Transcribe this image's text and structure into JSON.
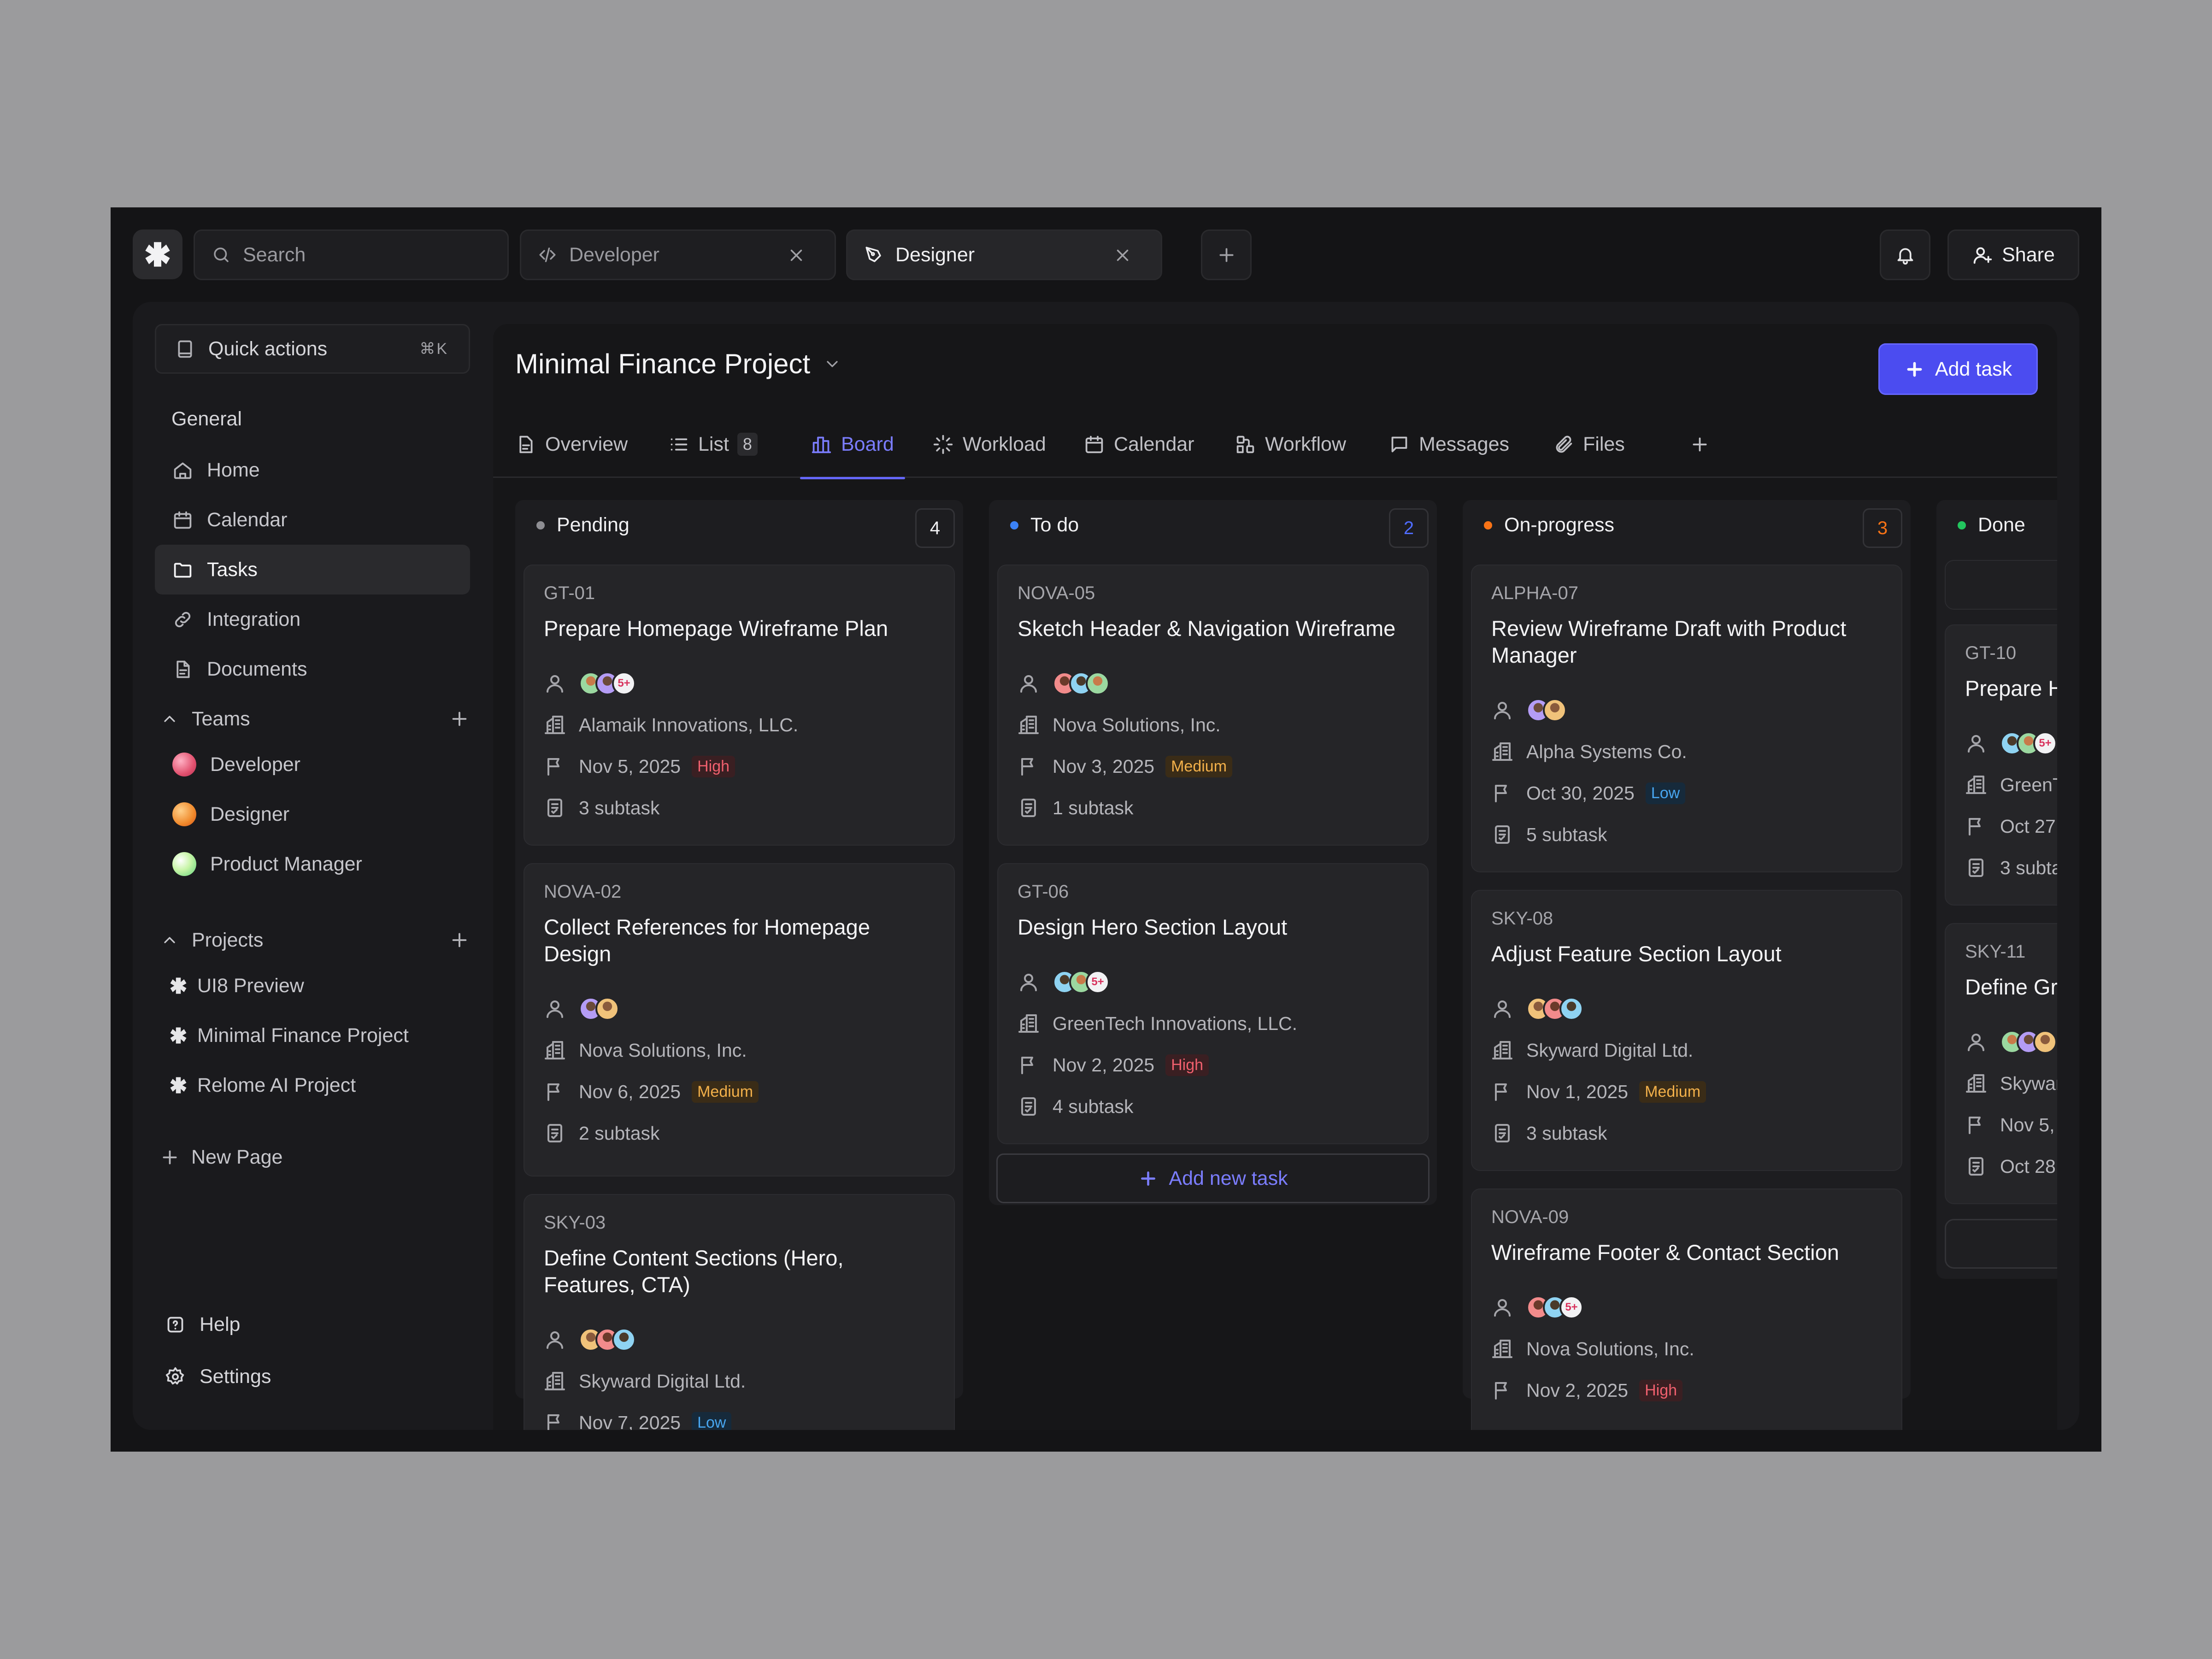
{
  "topbar": {
    "search_placeholder": "Search",
    "tabs": [
      {
        "label": "Developer"
      },
      {
        "label": "Designer"
      }
    ],
    "share_label": "Share"
  },
  "sidebar": {
    "quick_actions": {
      "label": "Quick actions",
      "shortcut": "⌘K"
    },
    "general_label": "General",
    "nav": [
      {
        "label": "Home",
        "icon": "home-icon"
      },
      {
        "label": "Calendar",
        "icon": "calendar-icon"
      },
      {
        "label": "Tasks",
        "icon": "folder-icon",
        "selected": true
      },
      {
        "label": "Integration",
        "icon": "link-icon"
      },
      {
        "label": "Documents",
        "icon": "document-icon"
      }
    ],
    "teams_label": "Teams",
    "teams": [
      {
        "label": "Developer",
        "color": "#e2516f"
      },
      {
        "label": "Designer",
        "color": "#f08a2c"
      },
      {
        "label": "Product Manager",
        "color": "#9fe58a"
      }
    ],
    "projects_label": "Projects",
    "projects": [
      {
        "label": "UI8 Preview"
      },
      {
        "label": "Minimal Finance Project"
      },
      {
        "label": "Relome AI Project"
      }
    ],
    "new_page_label": "New Page",
    "help_label": "Help",
    "settings_label": "Settings"
  },
  "main": {
    "title": "Minimal Finance Project",
    "add_task_label": "Add task",
    "tabs": [
      {
        "label": "Overview"
      },
      {
        "label": "List",
        "count": "8"
      },
      {
        "label": "Board",
        "active": true
      },
      {
        "label": "Workload"
      },
      {
        "label": "Calendar"
      },
      {
        "label": "Workflow"
      },
      {
        "label": "Messages"
      },
      {
        "label": "Files"
      }
    ]
  },
  "board": {
    "columns": [
      {
        "name": "Pending",
        "count": "4",
        "dot_color": "#8e8e93",
        "count_color": "#f0f0f2",
        "cards": [
          {
            "id": "GT-01",
            "title": "Prepare Homepage Wireframe Plan",
            "more": "5+",
            "company": "Alamaik Innovations, LLC.",
            "date": "Nov 5, 2025",
            "priority": "High",
            "subtasks": "3 subtask"
          },
          {
            "id": "NOVA-02",
            "title": "Collect References for Homepage Design",
            "company": "Nova Solutions, Inc.",
            "date": "Nov 6, 2025",
            "priority": "Medium",
            "subtasks": "2 subtask"
          },
          {
            "id": "SKY-03",
            "title": "Define Content Sections (Hero, Features, CTA)",
            "company": "Skyward Digital Ltd.",
            "date": "Nov 7, 2025",
            "priority": "Low"
          }
        ]
      },
      {
        "name": "To do",
        "count": "2",
        "dot_color": "#3b82f6",
        "count_color": "#4f6cff",
        "cards": [
          {
            "id": "NOVA-05",
            "title": "Sketch Header & Navigation Wireframe",
            "company": "Nova Solutions, Inc.",
            "date": "Nov 3, 2025",
            "priority": "Medium",
            "subtasks": "1 subtask"
          },
          {
            "id": "GT-06",
            "title": "Design Hero Section Layout",
            "more": "5+",
            "company": "GreenTech Innovations, LLC.",
            "date": "Nov 2, 2025",
            "priority": "High",
            "subtasks": "4 subtask"
          }
        ],
        "add_new_label": "Add new task"
      },
      {
        "name": "On-progress",
        "count": "3",
        "dot_color": "#f97316",
        "count_color": "#f97316",
        "cards": [
          {
            "id": "ALPHA-07",
            "title": "Review Wireframe Draft with Product Manager",
            "company": "Alpha Systems Co.",
            "date": "Oct 30, 2025",
            "priority": "Low",
            "subtasks": "5 subtask"
          },
          {
            "id": "SKY-08",
            "title": "Adjust Feature Section Layout",
            "company": "Skyward Digital Ltd.",
            "date": "Nov 1, 2025",
            "priority": "Medium",
            "subtasks": "3 subtask"
          },
          {
            "id": "NOVA-09",
            "title": "Wireframe Footer & Contact Section",
            "more": "5+",
            "company": "Nova Solutions, Inc.",
            "date": "Nov 2, 2025",
            "priority": "High"
          }
        ]
      },
      {
        "name": "Done",
        "dot_color": "#22c55e",
        "cards": [
          {
            "id": "GT-10",
            "title": "Prepare H",
            "more": "5+",
            "company": "GreenT",
            "date": "Oct 27,",
            "subtasks": "3 subta"
          },
          {
            "id": "SKY-11",
            "title": "Define Gri",
            "company": "Skywar",
            "date": "Nov 5,",
            "subtasks": "Oct 28"
          }
        ]
      }
    ]
  },
  "colors": {
    "accent": "#4b4cf0",
    "high": "#f0606e",
    "medium": "#f2b04a",
    "low": "#48a6f0"
  }
}
